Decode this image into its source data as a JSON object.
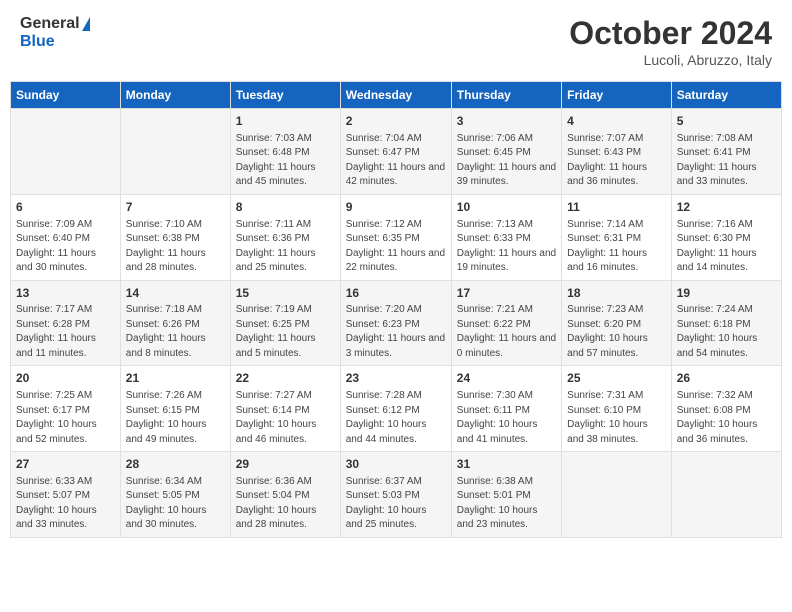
{
  "header": {
    "logo_general": "General",
    "logo_blue": "Blue",
    "month_title": "October 2024",
    "subtitle": "Lucoli, Abruzzo, Italy"
  },
  "weekdays": [
    "Sunday",
    "Monday",
    "Tuesday",
    "Wednesday",
    "Thursday",
    "Friday",
    "Saturday"
  ],
  "weeks": [
    [
      {
        "day": "",
        "sunrise": "",
        "sunset": "",
        "daylight": ""
      },
      {
        "day": "",
        "sunrise": "",
        "sunset": "",
        "daylight": ""
      },
      {
        "day": "1",
        "sunrise": "Sunrise: 7:03 AM",
        "sunset": "Sunset: 6:48 PM",
        "daylight": "Daylight: 11 hours and 45 minutes."
      },
      {
        "day": "2",
        "sunrise": "Sunrise: 7:04 AM",
        "sunset": "Sunset: 6:47 PM",
        "daylight": "Daylight: 11 hours and 42 minutes."
      },
      {
        "day": "3",
        "sunrise": "Sunrise: 7:06 AM",
        "sunset": "Sunset: 6:45 PM",
        "daylight": "Daylight: 11 hours and 39 minutes."
      },
      {
        "day": "4",
        "sunrise": "Sunrise: 7:07 AM",
        "sunset": "Sunset: 6:43 PM",
        "daylight": "Daylight: 11 hours and 36 minutes."
      },
      {
        "day": "5",
        "sunrise": "Sunrise: 7:08 AM",
        "sunset": "Sunset: 6:41 PM",
        "daylight": "Daylight: 11 hours and 33 minutes."
      }
    ],
    [
      {
        "day": "6",
        "sunrise": "Sunrise: 7:09 AM",
        "sunset": "Sunset: 6:40 PM",
        "daylight": "Daylight: 11 hours and 30 minutes."
      },
      {
        "day": "7",
        "sunrise": "Sunrise: 7:10 AM",
        "sunset": "Sunset: 6:38 PM",
        "daylight": "Daylight: 11 hours and 28 minutes."
      },
      {
        "day": "8",
        "sunrise": "Sunrise: 7:11 AM",
        "sunset": "Sunset: 6:36 PM",
        "daylight": "Daylight: 11 hours and 25 minutes."
      },
      {
        "day": "9",
        "sunrise": "Sunrise: 7:12 AM",
        "sunset": "Sunset: 6:35 PM",
        "daylight": "Daylight: 11 hours and 22 minutes."
      },
      {
        "day": "10",
        "sunrise": "Sunrise: 7:13 AM",
        "sunset": "Sunset: 6:33 PM",
        "daylight": "Daylight: 11 hours and 19 minutes."
      },
      {
        "day": "11",
        "sunrise": "Sunrise: 7:14 AM",
        "sunset": "Sunset: 6:31 PM",
        "daylight": "Daylight: 11 hours and 16 minutes."
      },
      {
        "day": "12",
        "sunrise": "Sunrise: 7:16 AM",
        "sunset": "Sunset: 6:30 PM",
        "daylight": "Daylight: 11 hours and 14 minutes."
      }
    ],
    [
      {
        "day": "13",
        "sunrise": "Sunrise: 7:17 AM",
        "sunset": "Sunset: 6:28 PM",
        "daylight": "Daylight: 11 hours and 11 minutes."
      },
      {
        "day": "14",
        "sunrise": "Sunrise: 7:18 AM",
        "sunset": "Sunset: 6:26 PM",
        "daylight": "Daylight: 11 hours and 8 minutes."
      },
      {
        "day": "15",
        "sunrise": "Sunrise: 7:19 AM",
        "sunset": "Sunset: 6:25 PM",
        "daylight": "Daylight: 11 hours and 5 minutes."
      },
      {
        "day": "16",
        "sunrise": "Sunrise: 7:20 AM",
        "sunset": "Sunset: 6:23 PM",
        "daylight": "Daylight: 11 hours and 3 minutes."
      },
      {
        "day": "17",
        "sunrise": "Sunrise: 7:21 AM",
        "sunset": "Sunset: 6:22 PM",
        "daylight": "Daylight: 11 hours and 0 minutes."
      },
      {
        "day": "18",
        "sunrise": "Sunrise: 7:23 AM",
        "sunset": "Sunset: 6:20 PM",
        "daylight": "Daylight: 10 hours and 57 minutes."
      },
      {
        "day": "19",
        "sunrise": "Sunrise: 7:24 AM",
        "sunset": "Sunset: 6:18 PM",
        "daylight": "Daylight: 10 hours and 54 minutes."
      }
    ],
    [
      {
        "day": "20",
        "sunrise": "Sunrise: 7:25 AM",
        "sunset": "Sunset: 6:17 PM",
        "daylight": "Daylight: 10 hours and 52 minutes."
      },
      {
        "day": "21",
        "sunrise": "Sunrise: 7:26 AM",
        "sunset": "Sunset: 6:15 PM",
        "daylight": "Daylight: 10 hours and 49 minutes."
      },
      {
        "day": "22",
        "sunrise": "Sunrise: 7:27 AM",
        "sunset": "Sunset: 6:14 PM",
        "daylight": "Daylight: 10 hours and 46 minutes."
      },
      {
        "day": "23",
        "sunrise": "Sunrise: 7:28 AM",
        "sunset": "Sunset: 6:12 PM",
        "daylight": "Daylight: 10 hours and 44 minutes."
      },
      {
        "day": "24",
        "sunrise": "Sunrise: 7:30 AM",
        "sunset": "Sunset: 6:11 PM",
        "daylight": "Daylight: 10 hours and 41 minutes."
      },
      {
        "day": "25",
        "sunrise": "Sunrise: 7:31 AM",
        "sunset": "Sunset: 6:10 PM",
        "daylight": "Daylight: 10 hours and 38 minutes."
      },
      {
        "day": "26",
        "sunrise": "Sunrise: 7:32 AM",
        "sunset": "Sunset: 6:08 PM",
        "daylight": "Daylight: 10 hours and 36 minutes."
      }
    ],
    [
      {
        "day": "27",
        "sunrise": "Sunrise: 6:33 AM",
        "sunset": "Sunset: 5:07 PM",
        "daylight": "Daylight: 10 hours and 33 minutes."
      },
      {
        "day": "28",
        "sunrise": "Sunrise: 6:34 AM",
        "sunset": "Sunset: 5:05 PM",
        "daylight": "Daylight: 10 hours and 30 minutes."
      },
      {
        "day": "29",
        "sunrise": "Sunrise: 6:36 AM",
        "sunset": "Sunset: 5:04 PM",
        "daylight": "Daylight: 10 hours and 28 minutes."
      },
      {
        "day": "30",
        "sunrise": "Sunrise: 6:37 AM",
        "sunset": "Sunset: 5:03 PM",
        "daylight": "Daylight: 10 hours and 25 minutes."
      },
      {
        "day": "31",
        "sunrise": "Sunrise: 6:38 AM",
        "sunset": "Sunset: 5:01 PM",
        "daylight": "Daylight: 10 hours and 23 minutes."
      },
      {
        "day": "",
        "sunrise": "",
        "sunset": "",
        "daylight": ""
      },
      {
        "day": "",
        "sunrise": "",
        "sunset": "",
        "daylight": ""
      }
    ]
  ]
}
